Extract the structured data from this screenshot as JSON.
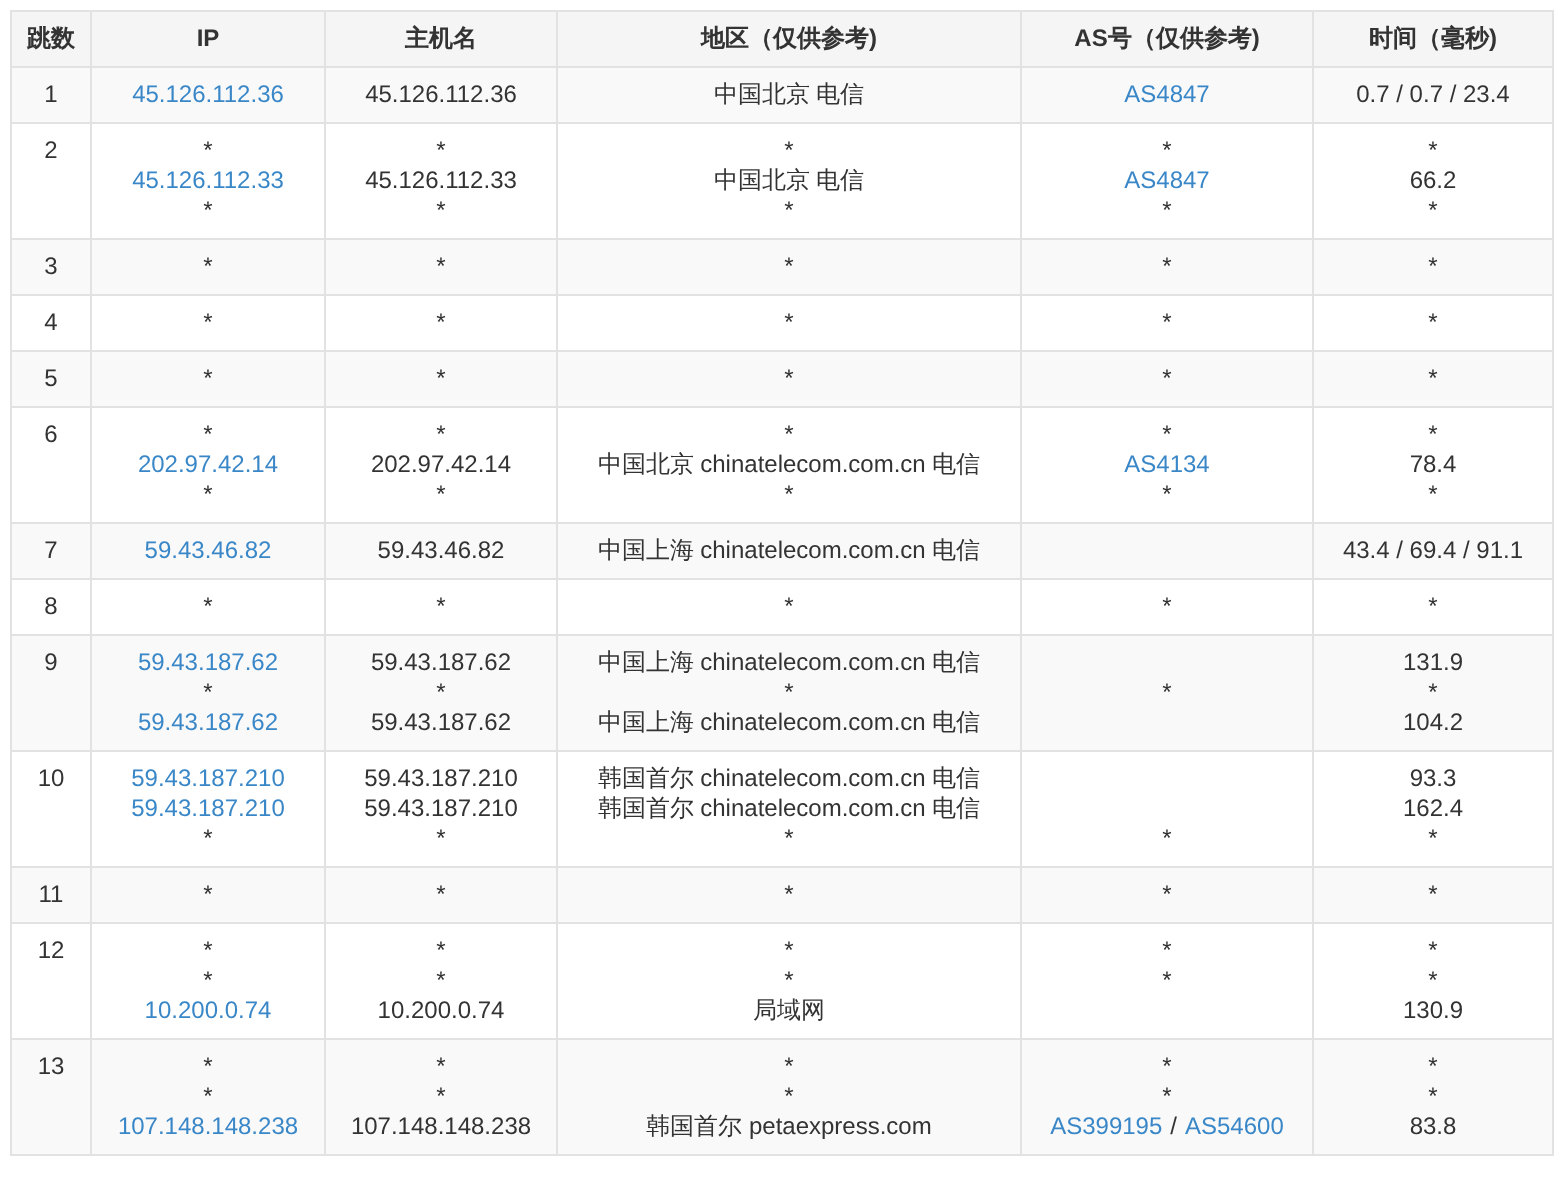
{
  "columns": [
    "跳数",
    "IP",
    "主机名",
    "地区（仅供参考)",
    "AS号（仅供参考)",
    "时间（毫秒)"
  ],
  "rows": [
    {
      "hop": "1",
      "probes": [
        {
          "ip": {
            "text": "45.126.112.36",
            "link": true
          },
          "host": "45.126.112.36",
          "region": "中国北京 电信",
          "as": {
            "text": "AS4847",
            "link": true
          },
          "time": "0.7 / 0.7 / 23.4"
        }
      ]
    },
    {
      "hop": "2",
      "probes": [
        {
          "ip": {
            "text": "*",
            "link": false
          },
          "host": "*",
          "region": "*",
          "as": {
            "text": "*",
            "link": false
          },
          "time": "*"
        },
        {
          "ip": {
            "text": "45.126.112.33",
            "link": true
          },
          "host": "45.126.112.33",
          "region": "中国北京 电信",
          "as": {
            "text": "AS4847",
            "link": true
          },
          "time": "66.2"
        },
        {
          "ip": {
            "text": "*",
            "link": false
          },
          "host": "*",
          "region": "*",
          "as": {
            "text": "*",
            "link": false
          },
          "time": "*"
        }
      ]
    },
    {
      "hop": "3",
      "probes": [
        {
          "ip": {
            "text": "*",
            "link": false
          },
          "host": "*",
          "region": "*",
          "as": {
            "text": "*",
            "link": false
          },
          "time": "*"
        }
      ]
    },
    {
      "hop": "4",
      "probes": [
        {
          "ip": {
            "text": "*",
            "link": false
          },
          "host": "*",
          "region": "*",
          "as": {
            "text": "*",
            "link": false
          },
          "time": "*"
        }
      ]
    },
    {
      "hop": "5",
      "probes": [
        {
          "ip": {
            "text": "*",
            "link": false
          },
          "host": "*",
          "region": "*",
          "as": {
            "text": "*",
            "link": false
          },
          "time": "*"
        }
      ]
    },
    {
      "hop": "6",
      "probes": [
        {
          "ip": {
            "text": "*",
            "link": false
          },
          "host": "*",
          "region": "*",
          "as": {
            "text": "*",
            "link": false
          },
          "time": "*"
        },
        {
          "ip": {
            "text": "202.97.42.14",
            "link": true
          },
          "host": "202.97.42.14",
          "region": "中国北京 chinatelecom.com.cn 电信",
          "as": {
            "text": "AS4134",
            "link": true
          },
          "time": "78.4"
        },
        {
          "ip": {
            "text": "*",
            "link": false
          },
          "host": "*",
          "region": "*",
          "as": {
            "text": "*",
            "link": false
          },
          "time": "*"
        }
      ]
    },
    {
      "hop": "7",
      "probes": [
        {
          "ip": {
            "text": "59.43.46.82",
            "link": true
          },
          "host": "59.43.46.82",
          "region": "中国上海 chinatelecom.com.cn 电信",
          "time": "43.4 / 69.4 / 91.1"
        }
      ]
    },
    {
      "hop": "8",
      "probes": [
        {
          "ip": {
            "text": "*",
            "link": false
          },
          "host": "*",
          "region": "*",
          "as": {
            "text": "*",
            "link": false
          },
          "time": "*"
        }
      ]
    },
    {
      "hop": "9",
      "probes": [
        {
          "ip": {
            "text": "59.43.187.62",
            "link": true
          },
          "host": "59.43.187.62",
          "region": "中国上海 chinatelecom.com.cn 电信",
          "time": "131.9"
        },
        {
          "ip": {
            "text": "*",
            "link": false
          },
          "host": "*",
          "region": "*",
          "as": {
            "text": "*",
            "link": false
          },
          "time": "*"
        },
        {
          "ip": {
            "text": "59.43.187.62",
            "link": true
          },
          "host": "59.43.187.62",
          "region": "中国上海 chinatelecom.com.cn 电信",
          "time": "104.2"
        }
      ]
    },
    {
      "hop": "10",
      "probes": [
        {
          "ip": {
            "text": "59.43.187.210",
            "link": true
          },
          "host": "59.43.187.210",
          "region": "韩国首尔 chinatelecom.com.cn 电信",
          "time": "93.3"
        },
        {
          "ip": {
            "text": "59.43.187.210",
            "link": true
          },
          "host": "59.43.187.210",
          "region": "韩国首尔 chinatelecom.com.cn 电信",
          "time": "162.4"
        },
        {
          "ip": {
            "text": "*",
            "link": false
          },
          "host": "*",
          "region": "*",
          "as": {
            "text": "*",
            "link": false
          },
          "time": "*"
        }
      ]
    },
    {
      "hop": "11",
      "probes": [
        {
          "ip": {
            "text": "*",
            "link": false
          },
          "host": "*",
          "region": "*",
          "as": {
            "text": "*",
            "link": false
          },
          "time": "*"
        }
      ]
    },
    {
      "hop": "12",
      "probes": [
        {
          "ip": {
            "text": "*",
            "link": false
          },
          "host": "*",
          "region": "*",
          "as": {
            "text": "*",
            "link": false
          },
          "time": "*"
        },
        {
          "ip": {
            "text": "*",
            "link": false
          },
          "host": "*",
          "region": "*",
          "as": {
            "text": "*",
            "link": false
          },
          "time": "*"
        },
        {
          "ip": {
            "text": "10.200.0.74",
            "link": true
          },
          "host": "10.200.0.74",
          "region": "局域网",
          "time": "130.9"
        }
      ]
    },
    {
      "hop": "13",
      "probes": [
        {
          "ip": {
            "text": "*",
            "link": false
          },
          "host": "*",
          "region": "*",
          "as": {
            "text": "*",
            "link": false
          },
          "time": "*"
        },
        {
          "ip": {
            "text": "*",
            "link": false
          },
          "host": "*",
          "region": "*",
          "as": {
            "text": "*",
            "link": false
          },
          "time": "*"
        },
        {
          "ip": {
            "text": "107.148.148.238",
            "link": true
          },
          "host": "107.148.148.238",
          "region": "韩国首尔 petaexpress.com",
          "as": {
            "parts": [
              {
                "text": "AS399195",
                "link": true
              },
              {
                "text": "/",
                "link": false
              },
              {
                "text": "AS54600",
                "link": true
              }
            ]
          },
          "time": "83.8"
        }
      ]
    }
  ]
}
